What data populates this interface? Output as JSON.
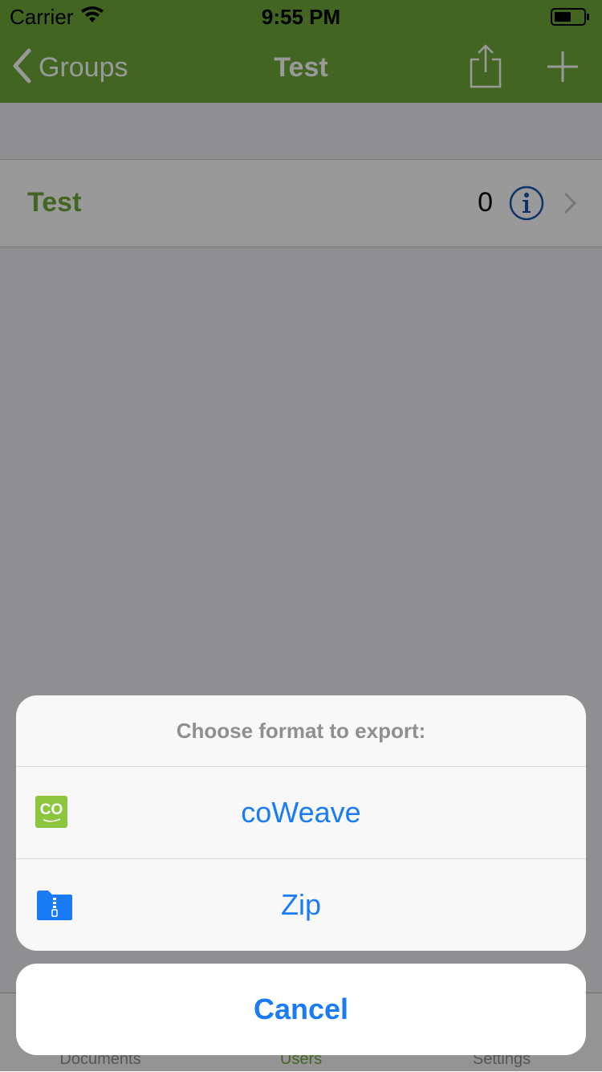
{
  "status_bar": {
    "carrier": "Carrier",
    "time": "9:55 PM"
  },
  "nav": {
    "back_label": "Groups",
    "title": "Test"
  },
  "list": [
    {
      "title": "Test",
      "count": "0"
    }
  ],
  "tabs": [
    {
      "label": "Documents",
      "active": false
    },
    {
      "label": "Users",
      "active": true
    },
    {
      "label": "Settings",
      "active": false
    }
  ],
  "action_sheet": {
    "title": "Choose format to export:",
    "options": [
      {
        "label": "coWeave",
        "icon": "coweave-app-icon"
      },
      {
        "label": "Zip",
        "icon": "zip-folder-icon"
      }
    ],
    "cancel_label": "Cancel"
  },
  "colors": {
    "brand_green": "#6ea839",
    "ios_blue": "#1a7cf5",
    "info_blue": "#1557b0"
  }
}
